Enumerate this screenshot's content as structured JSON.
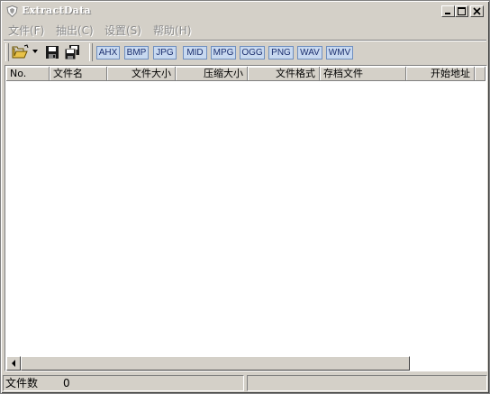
{
  "window": {
    "title": "ExtractData"
  },
  "menu": {
    "items": [
      {
        "label": "文件(F)"
      },
      {
        "label": "抽出(C)"
      },
      {
        "label": "设置(S)"
      },
      {
        "label": "帮助(H)"
      }
    ]
  },
  "toolbar": {
    "icons": [
      "open-folder-icon",
      "save-icon",
      "save-all-icon"
    ],
    "formats": [
      "AHX",
      "BMP",
      "JPG",
      "MID",
      "MPG",
      "OGG",
      "PNG",
      "WAV",
      "WMV"
    ]
  },
  "list": {
    "columns": [
      "No.",
      "文件名",
      "文件大小",
      "压缩大小",
      "文件格式",
      "存档文件",
      "开始地址"
    ],
    "rows": []
  },
  "status": {
    "file_count_label": "文件数",
    "file_count_value": "0"
  },
  "colors": {
    "face": "#d4d0c8",
    "format_button": "#c8d9f0",
    "format_text": "#1c2f6e"
  }
}
